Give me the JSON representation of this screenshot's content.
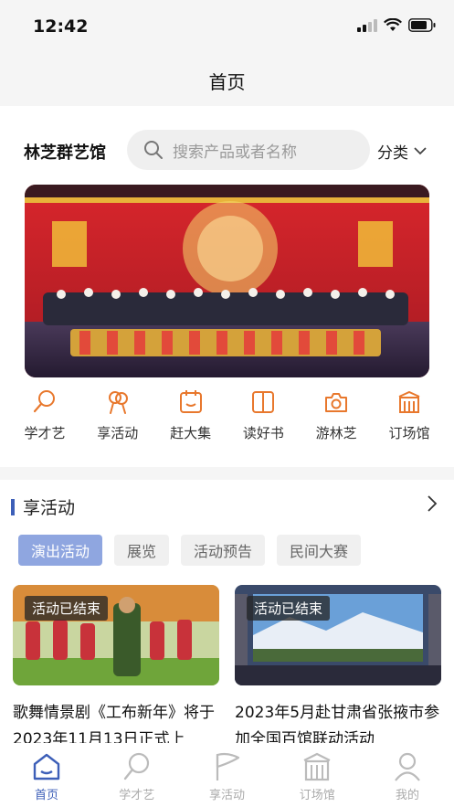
{
  "status_bar": {
    "time": "12:42"
  },
  "nav": {
    "title": "首页"
  },
  "header": {
    "brand": "林芝群艺馆",
    "search_placeholder": "搜索产品或者名称",
    "category_label": "分类"
  },
  "quick_entries": [
    {
      "label": "学才艺",
      "icon": "magnifier-icon"
    },
    {
      "label": "享活动",
      "icon": "ribbon-icon"
    },
    {
      "label": "赶大集",
      "icon": "calendar-icon"
    },
    {
      "label": "读好书",
      "icon": "book-icon"
    },
    {
      "label": "游林芝",
      "icon": "camera-icon"
    },
    {
      "label": "订场馆",
      "icon": "building-icon"
    }
  ],
  "activity": {
    "title": "享活动",
    "filters": [
      "演出活动",
      "展览",
      "活动预告",
      "民间大赛"
    ],
    "active_filter": "演出活动",
    "cards": [
      {
        "badge": "活动已结束",
        "title": "歌舞情景剧《工布新年》将于2023年11月13日正式上"
      },
      {
        "badge": "活动已结束",
        "title": "2023年5月赴甘肃省张掖市参加全国百馆联动活动"
      }
    ]
  },
  "tabbar": [
    {
      "label": "首页",
      "icon": "home-icon",
      "active": true
    },
    {
      "label": "学才艺",
      "icon": "magnifier-icon",
      "active": false
    },
    {
      "label": "享活动",
      "icon": "flag-icon",
      "active": false
    },
    {
      "label": "订场馆",
      "icon": "building-icon",
      "active": false
    },
    {
      "label": "我的",
      "icon": "user-icon",
      "active": false
    }
  ],
  "colors": {
    "accent": "#e8782d",
    "brand_blue": "#3d5fb8",
    "chip_active": "#8fa6e0"
  }
}
